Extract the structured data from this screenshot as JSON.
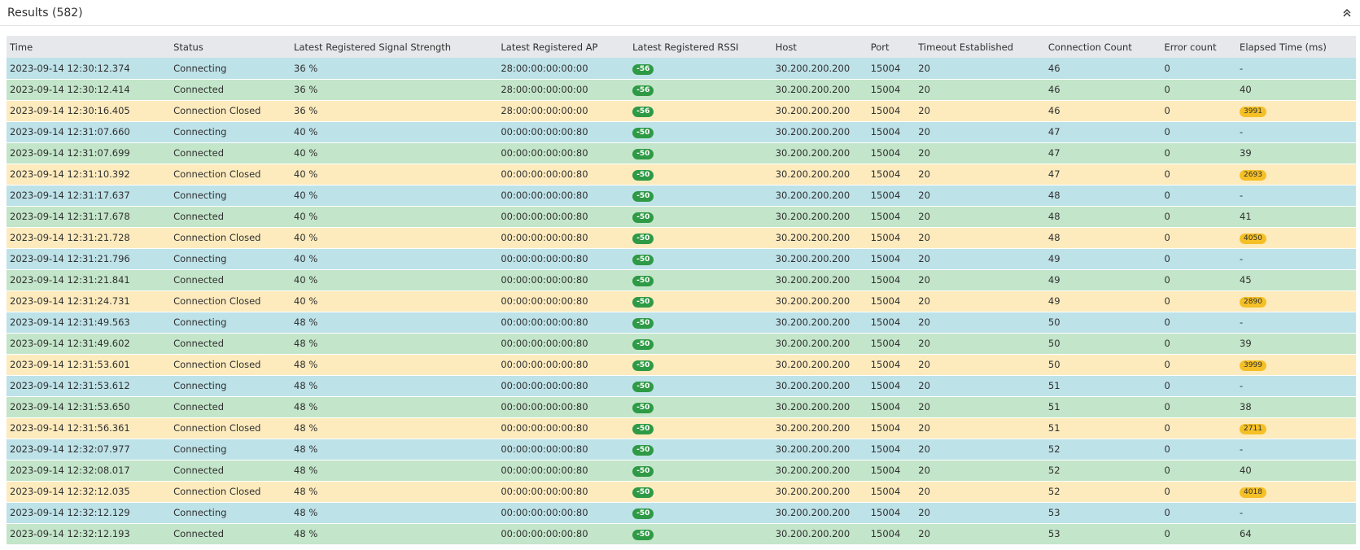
{
  "panel": {
    "title": "Results (582)",
    "collapse_icon": "chevron-double-up-icon"
  },
  "columns": [
    "Time",
    "Status",
    "Latest Registered Signal Strength",
    "Latest Registered AP",
    "Latest Registered RSSI",
    "Host",
    "Port",
    "Timeout Established",
    "Connection Count",
    "Error count",
    "Elapsed Time (ms)"
  ],
  "colors": {
    "connecting": "#bde2e8",
    "connected": "#c3e5c9",
    "closed": "#fdebbe",
    "rssi_badge": "#2e9a45",
    "elapsed_badge": "#f5c026"
  },
  "rows": [
    {
      "time": "2023-09-14 12:30:12.374",
      "status": "Connecting",
      "signal": "36 %",
      "ap": "28:00:00:00:00:00",
      "rssi": "-56",
      "host": "30.200.200.200",
      "port": "15004",
      "timeout": "20",
      "count": "46",
      "errors": "0",
      "elapsed": "-"
    },
    {
      "time": "2023-09-14 12:30:12.414",
      "status": "Connected",
      "signal": "36 %",
      "ap": "28:00:00:00:00:00",
      "rssi": "-56",
      "host": "30.200.200.200",
      "port": "15004",
      "timeout": "20",
      "count": "46",
      "errors": "0",
      "elapsed": "40"
    },
    {
      "time": "2023-09-14 12:30:16.405",
      "status": "Connection Closed",
      "signal": "36 %",
      "ap": "28:00:00:00:00:00",
      "rssi": "-56",
      "host": "30.200.200.200",
      "port": "15004",
      "timeout": "20",
      "count": "46",
      "errors": "0",
      "elapsed": "3991"
    },
    {
      "time": "2023-09-14 12:31:07.660",
      "status": "Connecting",
      "signal": "40 %",
      "ap": "00:00:00:00:00:80",
      "rssi": "-50",
      "host": "30.200.200.200",
      "port": "15004",
      "timeout": "20",
      "count": "47",
      "errors": "0",
      "elapsed": "-"
    },
    {
      "time": "2023-09-14 12:31:07.699",
      "status": "Connected",
      "signal": "40 %",
      "ap": "00:00:00:00:00:80",
      "rssi": "-50",
      "host": "30.200.200.200",
      "port": "15004",
      "timeout": "20",
      "count": "47",
      "errors": "0",
      "elapsed": "39"
    },
    {
      "time": "2023-09-14 12:31:10.392",
      "status": "Connection Closed",
      "signal": "40 %",
      "ap": "00:00:00:00:00:80",
      "rssi": "-50",
      "host": "30.200.200.200",
      "port": "15004",
      "timeout": "20",
      "count": "47",
      "errors": "0",
      "elapsed": "2693"
    },
    {
      "time": "2023-09-14 12:31:17.637",
      "status": "Connecting",
      "signal": "40 %",
      "ap": "00:00:00:00:00:80",
      "rssi": "-50",
      "host": "30.200.200.200",
      "port": "15004",
      "timeout": "20",
      "count": "48",
      "errors": "0",
      "elapsed": "-"
    },
    {
      "time": "2023-09-14 12:31:17.678",
      "status": "Connected",
      "signal": "40 %",
      "ap": "00:00:00:00:00:80",
      "rssi": "-50",
      "host": "30.200.200.200",
      "port": "15004",
      "timeout": "20",
      "count": "48",
      "errors": "0",
      "elapsed": "41"
    },
    {
      "time": "2023-09-14 12:31:21.728",
      "status": "Connection Closed",
      "signal": "40 %",
      "ap": "00:00:00:00:00:80",
      "rssi": "-50",
      "host": "30.200.200.200",
      "port": "15004",
      "timeout": "20",
      "count": "48",
      "errors": "0",
      "elapsed": "4050"
    },
    {
      "time": "2023-09-14 12:31:21.796",
      "status": "Connecting",
      "signal": "40 %",
      "ap": "00:00:00:00:00:80",
      "rssi": "-50",
      "host": "30.200.200.200",
      "port": "15004",
      "timeout": "20",
      "count": "49",
      "errors": "0",
      "elapsed": "-"
    },
    {
      "time": "2023-09-14 12:31:21.841",
      "status": "Connected",
      "signal": "40 %",
      "ap": "00:00:00:00:00:80",
      "rssi": "-50",
      "host": "30.200.200.200",
      "port": "15004",
      "timeout": "20",
      "count": "49",
      "errors": "0",
      "elapsed": "45"
    },
    {
      "time": "2023-09-14 12:31:24.731",
      "status": "Connection Closed",
      "signal": "40 %",
      "ap": "00:00:00:00:00:80",
      "rssi": "-50",
      "host": "30.200.200.200",
      "port": "15004",
      "timeout": "20",
      "count": "49",
      "errors": "0",
      "elapsed": "2890"
    },
    {
      "time": "2023-09-14 12:31:49.563",
      "status": "Connecting",
      "signal": "48 %",
      "ap": "00:00:00:00:00:80",
      "rssi": "-50",
      "host": "30.200.200.200",
      "port": "15004",
      "timeout": "20",
      "count": "50",
      "errors": "0",
      "elapsed": "-"
    },
    {
      "time": "2023-09-14 12:31:49.602",
      "status": "Connected",
      "signal": "48 %",
      "ap": "00:00:00:00:00:80",
      "rssi": "-50",
      "host": "30.200.200.200",
      "port": "15004",
      "timeout": "20",
      "count": "50",
      "errors": "0",
      "elapsed": "39"
    },
    {
      "time": "2023-09-14 12:31:53.601",
      "status": "Connection Closed",
      "signal": "48 %",
      "ap": "00:00:00:00:00:80",
      "rssi": "-50",
      "host": "30.200.200.200",
      "port": "15004",
      "timeout": "20",
      "count": "50",
      "errors": "0",
      "elapsed": "3999"
    },
    {
      "time": "2023-09-14 12:31:53.612",
      "status": "Connecting",
      "signal": "48 %",
      "ap": "00:00:00:00:00:80",
      "rssi": "-50",
      "host": "30.200.200.200",
      "port": "15004",
      "timeout": "20",
      "count": "51",
      "errors": "0",
      "elapsed": "-"
    },
    {
      "time": "2023-09-14 12:31:53.650",
      "status": "Connected",
      "signal": "48 %",
      "ap": "00:00:00:00:00:80",
      "rssi": "-50",
      "host": "30.200.200.200",
      "port": "15004",
      "timeout": "20",
      "count": "51",
      "errors": "0",
      "elapsed": "38"
    },
    {
      "time": "2023-09-14 12:31:56.361",
      "status": "Connection Closed",
      "signal": "48 %",
      "ap": "00:00:00:00:00:80",
      "rssi": "-50",
      "host": "30.200.200.200",
      "port": "15004",
      "timeout": "20",
      "count": "51",
      "errors": "0",
      "elapsed": "2711"
    },
    {
      "time": "2023-09-14 12:32:07.977",
      "status": "Connecting",
      "signal": "48 %",
      "ap": "00:00:00:00:00:80",
      "rssi": "-50",
      "host": "30.200.200.200",
      "port": "15004",
      "timeout": "20",
      "count": "52",
      "errors": "0",
      "elapsed": "-"
    },
    {
      "time": "2023-09-14 12:32:08.017",
      "status": "Connected",
      "signal": "48 %",
      "ap": "00:00:00:00:00:80",
      "rssi": "-50",
      "host": "30.200.200.200",
      "port": "15004",
      "timeout": "20",
      "count": "52",
      "errors": "0",
      "elapsed": "40"
    },
    {
      "time": "2023-09-14 12:32:12.035",
      "status": "Connection Closed",
      "signal": "48 %",
      "ap": "00:00:00:00:00:80",
      "rssi": "-50",
      "host": "30.200.200.200",
      "port": "15004",
      "timeout": "20",
      "count": "52",
      "errors": "0",
      "elapsed": "4018"
    },
    {
      "time": "2023-09-14 12:32:12.129",
      "status": "Connecting",
      "signal": "48 %",
      "ap": "00:00:00:00:00:80",
      "rssi": "-50",
      "host": "30.200.200.200",
      "port": "15004",
      "timeout": "20",
      "count": "53",
      "errors": "0",
      "elapsed": "-"
    },
    {
      "time": "2023-09-14 12:32:12.193",
      "status": "Connected",
      "signal": "48 %",
      "ap": "00:00:00:00:00:80",
      "rssi": "-50",
      "host": "30.200.200.200",
      "port": "15004",
      "timeout": "20",
      "count": "53",
      "errors": "0",
      "elapsed": "64"
    }
  ]
}
